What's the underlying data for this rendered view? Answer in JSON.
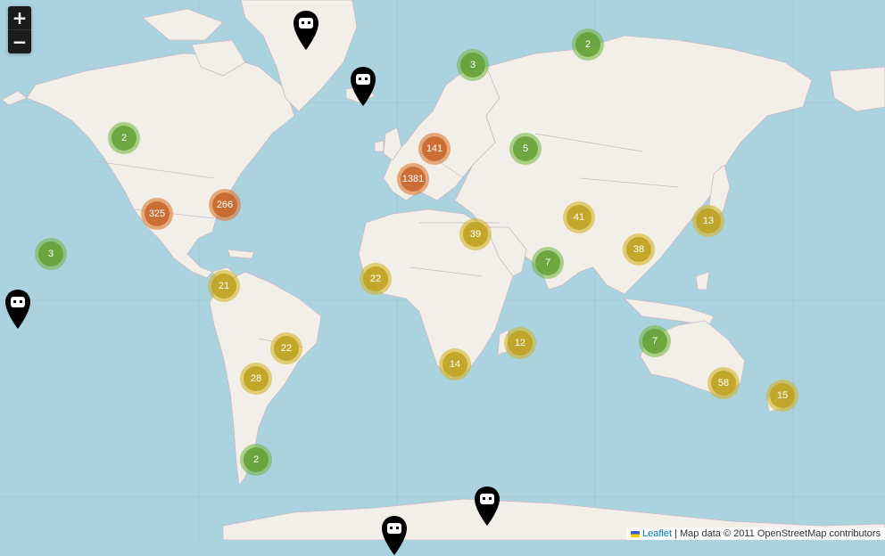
{
  "zoom": {
    "in_label": "+",
    "out_label": "−"
  },
  "clusters": [
    {
      "count": "2",
      "level": "small"
    },
    {
      "count": "3",
      "level": "small"
    },
    {
      "count": "2",
      "level": "small"
    },
    {
      "count": "141",
      "level": "large"
    },
    {
      "count": "5",
      "level": "small"
    },
    {
      "count": "1381",
      "level": "large"
    },
    {
      "count": "325",
      "level": "large"
    },
    {
      "count": "266",
      "level": "large"
    },
    {
      "count": "41",
      "level": "medium"
    },
    {
      "count": "13",
      "level": "medium"
    },
    {
      "count": "39",
      "level": "medium"
    },
    {
      "count": "38",
      "level": "medium"
    },
    {
      "count": "3",
      "level": "small"
    },
    {
      "count": "7",
      "level": "small"
    },
    {
      "count": "21",
      "level": "medium"
    },
    {
      "count": "22",
      "level": "medium"
    },
    {
      "count": "12",
      "level": "medium"
    },
    {
      "count": "22",
      "level": "medium"
    },
    {
      "count": "7",
      "level": "small"
    },
    {
      "count": "14",
      "level": "medium"
    },
    {
      "count": "28",
      "level": "medium"
    },
    {
      "count": "58",
      "level": "medium"
    },
    {
      "count": "15",
      "level": "medium"
    },
    {
      "count": "2",
      "level": "small"
    }
  ],
  "attribution": {
    "leaflet_label": "Leaflet",
    "text": "| Map data © 2011 OpenStreetMap contributors"
  },
  "colors": {
    "water": "#aad3df",
    "land": "#f2efe9",
    "small": "#6eb43c",
    "medium": "#d2b428",
    "large": "#dc7832"
  }
}
